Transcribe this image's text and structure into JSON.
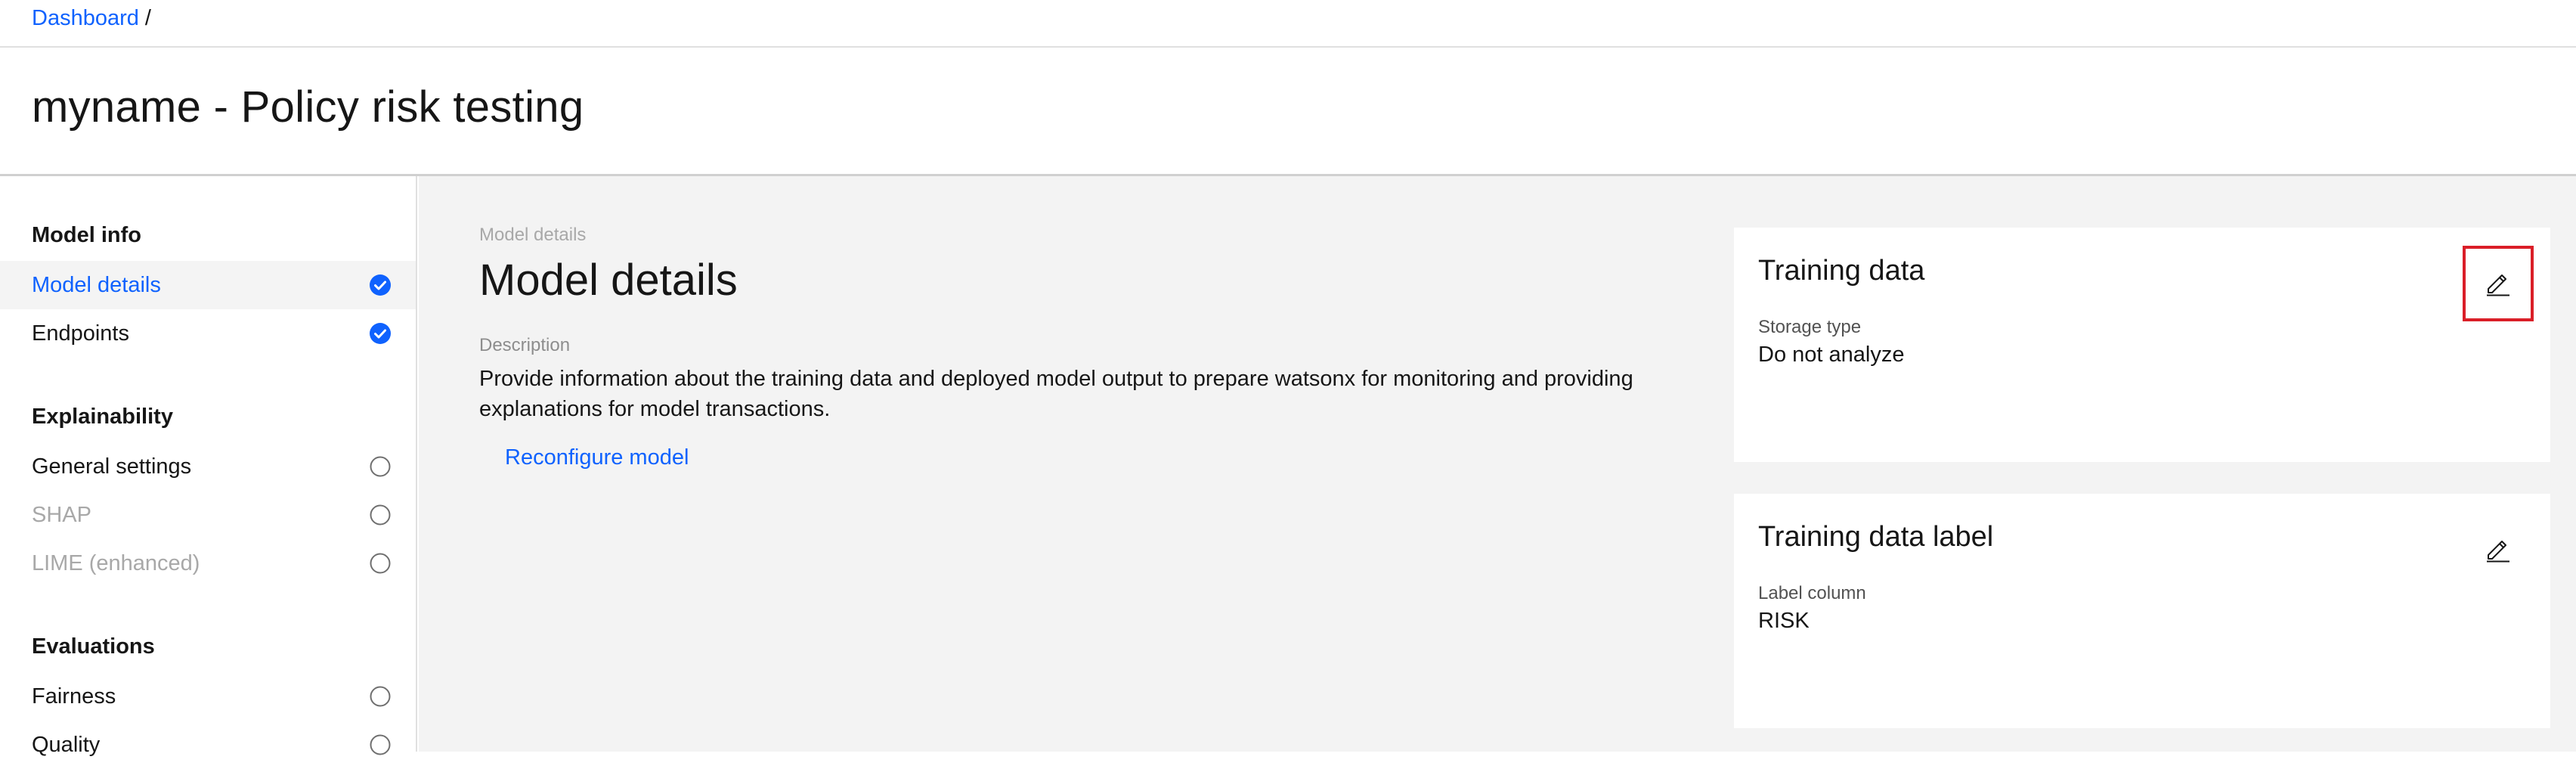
{
  "breadcrumb": {
    "items": [
      {
        "label": "Dashboard"
      }
    ],
    "separator": "/"
  },
  "page": {
    "title": "myname - Policy risk testing"
  },
  "sidebar": {
    "groups": [
      {
        "title": "Model info",
        "items": [
          {
            "label": "Model details",
            "status": "complete",
            "active": true
          },
          {
            "label": "Endpoints",
            "status": "complete"
          }
        ]
      },
      {
        "title": "Explainability",
        "items": [
          {
            "label": "General settings",
            "status": "incomplete"
          },
          {
            "label": "SHAP",
            "status": "incomplete",
            "disabled": true
          },
          {
            "label": "LIME (enhanced)",
            "status": "incomplete",
            "disabled": true
          }
        ]
      },
      {
        "title": "Evaluations",
        "items": [
          {
            "label": "Fairness",
            "status": "incomplete"
          },
          {
            "label": "Quality",
            "status": "incomplete"
          }
        ]
      }
    ]
  },
  "main": {
    "eyebrow": "Model details",
    "title": "Model details",
    "description_label": "Description",
    "description": "Provide information about the training data and deployed model output to prepare watsonx for monitoring and providing explanations for model transactions.",
    "reconfigure_link": "Reconfigure model"
  },
  "cards": [
    {
      "title": "Training data",
      "field_label": "Storage type",
      "field_value": "Do not analyze",
      "edit_icon": "edit-pencil-icon"
    },
    {
      "title": "Training data label",
      "field_label": "Label column",
      "field_value": "RISK",
      "edit_icon": "edit-pencil-icon"
    }
  ],
  "colors": {
    "accent": "#0f62fe",
    "highlight": "#da1e28",
    "main_bg": "#f3f3f3"
  },
  "icons": {
    "complete": "checkmark-filled-icon",
    "incomplete": "circle-outline-icon"
  }
}
